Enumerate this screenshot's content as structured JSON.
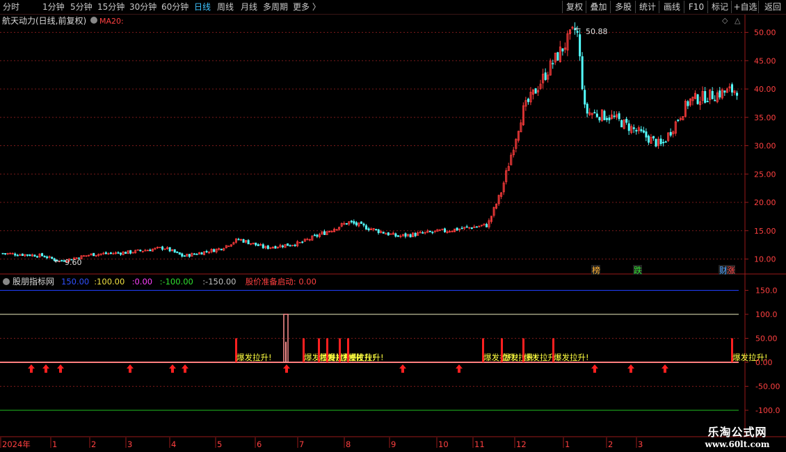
{
  "toolbar": {
    "periods": [
      {
        "label": "分时",
        "active": false
      },
      {
        "label": "1分钟",
        "active": false
      },
      {
        "label": "5分钟",
        "active": false
      },
      {
        "label": "15分钟",
        "active": false
      },
      {
        "label": "30分钟",
        "active": false
      },
      {
        "label": "60分钟",
        "active": false
      },
      {
        "label": "日线",
        "active": true
      },
      {
        "label": "周线",
        "active": false
      },
      {
        "label": "月线",
        "active": false
      },
      {
        "label": "多周期",
        "active": false
      },
      {
        "label": "更多",
        "active": false
      }
    ],
    "actions": [
      "复权",
      "叠加",
      "多股",
      "统计",
      "画线",
      "F10",
      "标记",
      "+自选",
      "返回"
    ]
  },
  "main_panel": {
    "title": "航天动力(日线,前复权)",
    "ma_label": "MA20:",
    "high_marker": "50.88",
    "low_marker": "9.60",
    "y_ticks": [
      "50.00",
      "45.00",
      "40.00",
      "35.00",
      "30.00",
      "25.00",
      "20.00",
      "15.00",
      "10.00"
    ],
    "badges": [
      {
        "text": "榜",
        "color": "#ffb030"
      },
      {
        "text": "跌",
        "color": "#30e030"
      },
      {
        "text": "财",
        "color": "#4aa0ff"
      },
      {
        "text": "涨",
        "color": "#ff4040"
      }
    ]
  },
  "indicator_panel": {
    "title": "股朋指标网",
    "values": [
      {
        "text": "150.00",
        "color": "#3050ff"
      },
      {
        "text": ":100.00",
        "color": "#f0e040"
      },
      {
        "text": ":0.00",
        "color": "#ff40ff"
      },
      {
        "text": ":-100.00",
        "color": "#30e030"
      },
      {
        "text": ":-150.00",
        "color": "#c0c0c0"
      },
      {
        "text": "股价准备启动: 0.00",
        "color": "#ff4040"
      }
    ],
    "y_ticks": [
      "150.0",
      "100.0",
      "50.00",
      "0.00",
      "-50.00",
      "-100.0"
    ],
    "signal_text": "爆发拉升!"
  },
  "x_axis": {
    "labels": [
      "2024年",
      "1",
      "2",
      "3",
      "4",
      "5",
      "6",
      "7",
      "8",
      "9",
      "10",
      "11",
      "12",
      "1",
      "2",
      "3"
    ]
  },
  "colors": {
    "up": "#ff3c3c",
    "down": "#54ffff",
    "grid": "#7a1a1a",
    "signal": "#ff2020",
    "signal_text": "#ffff40"
  },
  "chart_data": {
    "type": "candlestick",
    "title": "航天动力(日线,前复权)",
    "ylim": [
      8.5,
      52
    ],
    "points": [
      {
        "date": "2023-12",
        "close": 11.0
      },
      {
        "date": "2024-01",
        "close": 10.6
      },
      {
        "date": "2024-01-20",
        "close": 9.6
      },
      {
        "date": "2024-02",
        "close": 10.8
      },
      {
        "date": "2024-03",
        "close": 11.2
      },
      {
        "date": "2024-04",
        "close": 12.0
      },
      {
        "date": "2024-04-20",
        "close": 10.5
      },
      {
        "date": "2024-05",
        "close": 11.8
      },
      {
        "date": "2024-05-25",
        "close": 13.5
      },
      {
        "date": "2024-06",
        "close": 12.0
      },
      {
        "date": "2024-07",
        "close": 12.8
      },
      {
        "date": "2024-08",
        "close": 16.5
      },
      {
        "date": "2024-09",
        "close": 14.0
      },
      {
        "date": "2024-10",
        "close": 15.0
      },
      {
        "date": "2024-11",
        "close": 16.0
      },
      {
        "date": "2024-11-20",
        "close": 22.0
      },
      {
        "date": "2024-12",
        "close": 36.0
      },
      {
        "date": "2024-12-20",
        "close": 44.0
      },
      {
        "date": "2025-01",
        "close": 50.88
      },
      {
        "date": "2025-01-20",
        "close": 36.0
      },
      {
        "date": "2025-02",
        "close": 35.0
      },
      {
        "date": "2025-03",
        "close": 30.0
      },
      {
        "date": "2025-03-20",
        "close": 38.0
      },
      {
        "date": "2025-04",
        "close": 40.0
      }
    ],
    "indicator": {
      "ref_lines": [
        150,
        100,
        0,
        -100
      ],
      "signal_value": 50,
      "spike_value": 100
    }
  }
}
